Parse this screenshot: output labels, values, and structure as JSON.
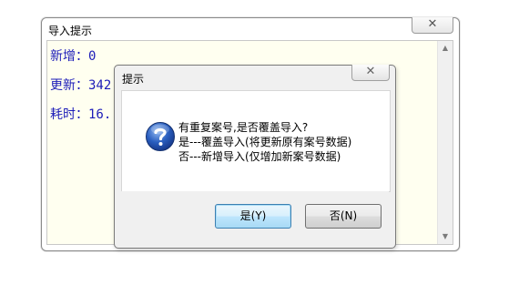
{
  "outer_window": {
    "title": "导入提示",
    "close_symbol": "✕",
    "log_lines": [
      "新增：0",
      "更新：342",
      "耗时：16."
    ],
    "scroll_up": "▲",
    "scroll_down": "▼"
  },
  "dialog": {
    "title": "提示",
    "close_symbol": "✕",
    "icon": "question-icon",
    "message_lines": [
      "有重复案号,是否覆盖导入?",
      "是---覆盖导入(将更新原有案号数据)",
      "否---新增导入(仅增加新案号数据)"
    ],
    "yes_label": "是(Y)",
    "no_label": "否(N)"
  },
  "colors": {
    "log_text": "#1c1cb8",
    "log_background": "#fffff0",
    "dialog_background": "#f0f0f0",
    "question_icon": "#1e4fa8"
  }
}
